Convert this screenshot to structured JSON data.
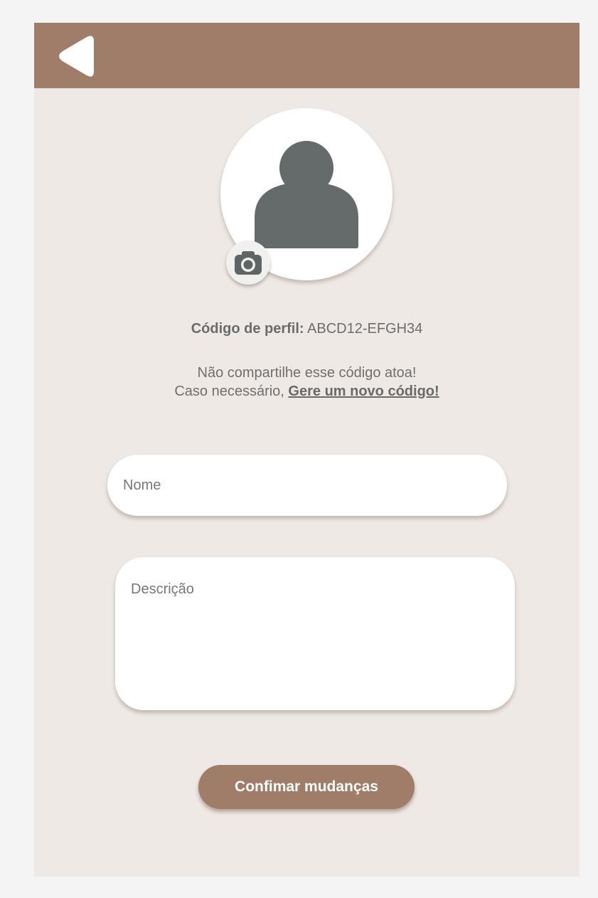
{
  "header": {
    "back_icon": "back-arrow-icon",
    "color": "#a07d69"
  },
  "profile": {
    "avatar_icon": "person-icon",
    "camera_icon": "camera-icon",
    "code_label": "Código de perfil:",
    "code_value": "ABCD12-EFGH34",
    "warning_line1": "Não compartilhe esse código atoa!",
    "warning_line2_prefix": "Caso necessário,",
    "generate_link": "Gere um novo código!"
  },
  "form": {
    "name_placeholder": "Nome",
    "name_value": "",
    "description_placeholder": "Descrição",
    "description_value": "",
    "confirm_label": "Confimar mudanças"
  },
  "colors": {
    "accent": "#a07d69",
    "background": "#efe9e5",
    "avatar_fill": "#656a6a"
  }
}
